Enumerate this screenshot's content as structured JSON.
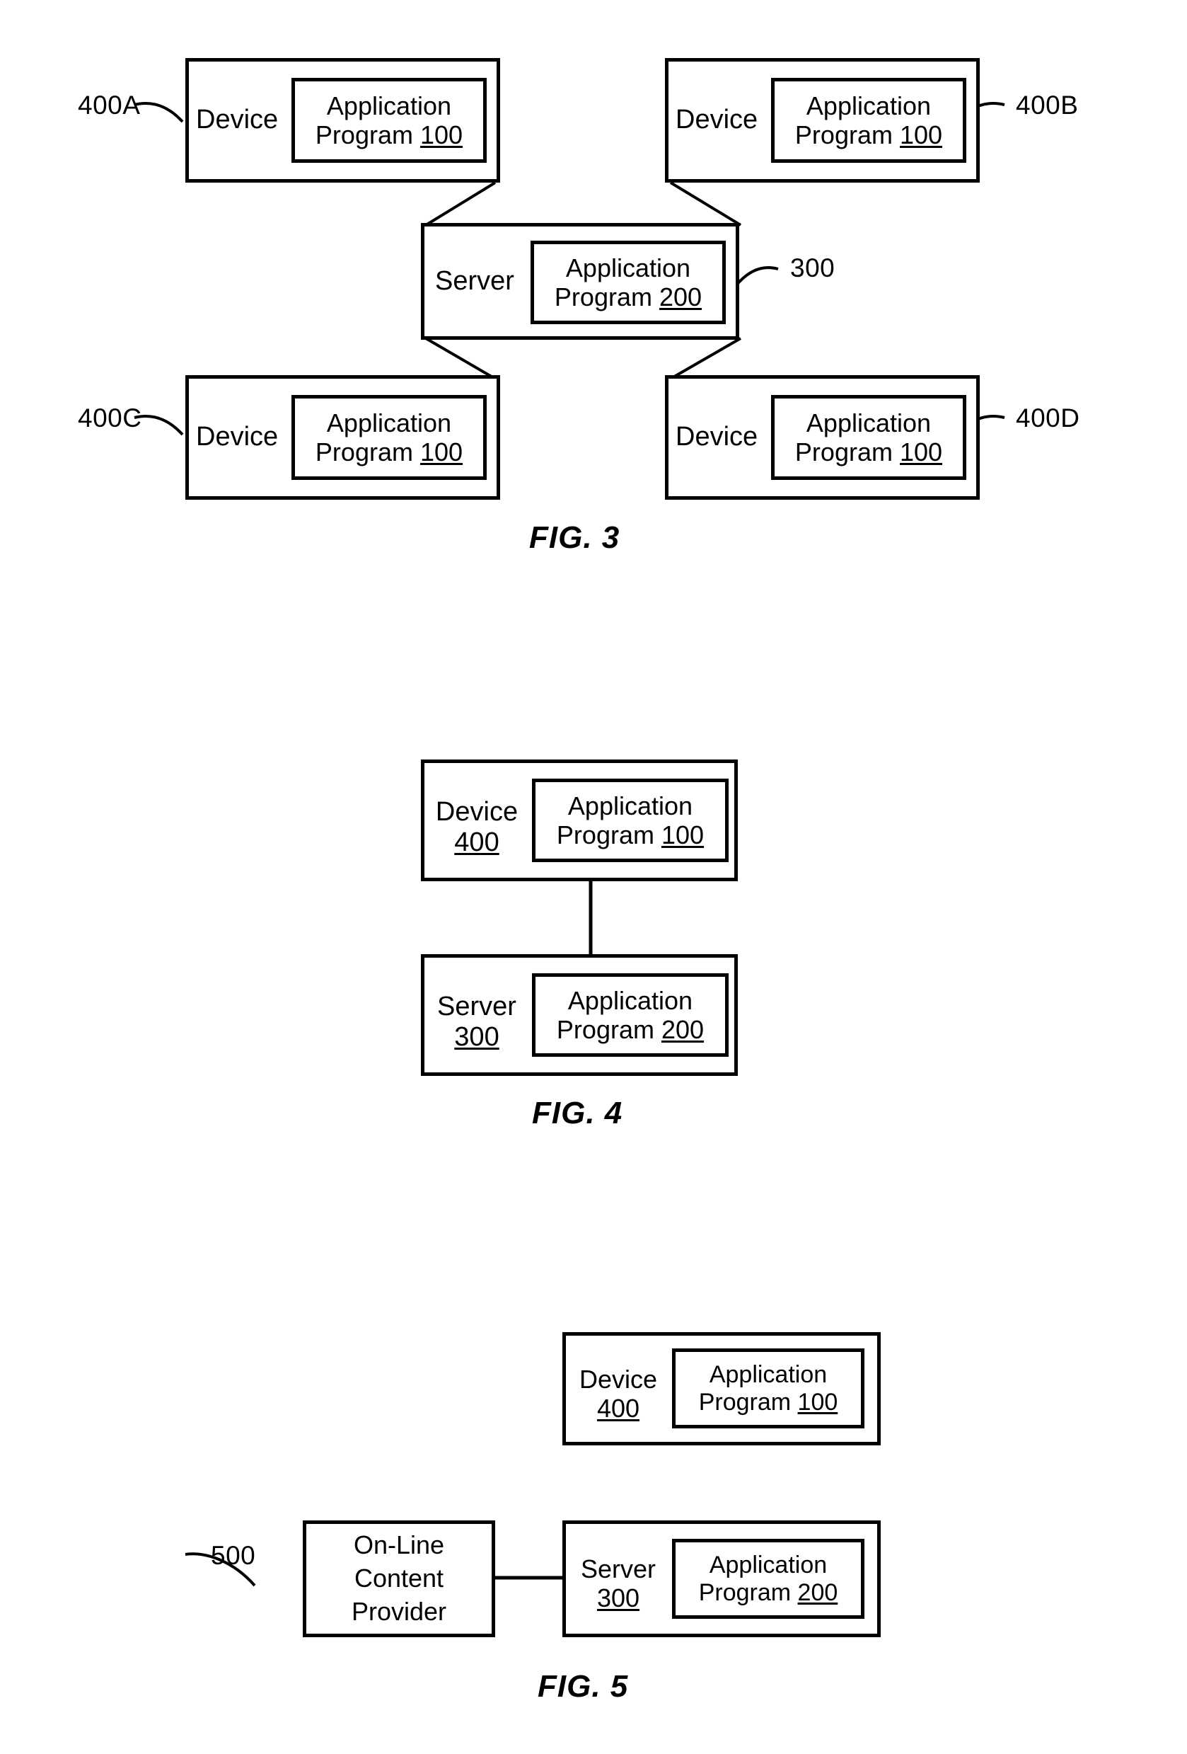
{
  "figures": [
    {
      "id": "fig3",
      "caption": "FIG. 3",
      "nodes": {
        "device_a": {
          "role_label": "Device",
          "program_line1": "Application",
          "program_line2": "Program",
          "program_ref": "100",
          "ref": "400A"
        },
        "device_b": {
          "role_label": "Device",
          "program_line1": "Application",
          "program_line2": "Program",
          "program_ref": "100",
          "ref": "400B"
        },
        "server": {
          "role_label": "Server",
          "program_line1": "Application",
          "program_line2": "Program",
          "program_ref": "200",
          "ref": "300"
        },
        "device_c": {
          "role_label": "Device",
          "program_line1": "Application",
          "program_line2": "Program",
          "program_ref": "100",
          "ref": "400C"
        },
        "device_d": {
          "role_label": "Device",
          "program_line1": "Application",
          "program_line2": "Program",
          "program_ref": "100",
          "ref": "400D"
        }
      }
    },
    {
      "id": "fig4",
      "caption": "FIG. 4",
      "nodes": {
        "device": {
          "role_label": "Device",
          "role_ref": "400",
          "program_line1": "Application",
          "program_line2": "Program",
          "program_ref": "100"
        },
        "server": {
          "role_label": "Server",
          "role_ref": "300",
          "program_line1": "Application",
          "program_line2": "Program",
          "program_ref": "200"
        }
      }
    },
    {
      "id": "fig5",
      "caption": "FIG. 5",
      "nodes": {
        "device": {
          "role_label": "Device",
          "role_ref": "400",
          "program_line1": "Application",
          "program_line2": "Program",
          "program_ref": "100"
        },
        "provider": {
          "line1": "On-Line",
          "line2": "Content",
          "line3": "Provider",
          "ref": "500"
        },
        "server": {
          "role_label": "Server",
          "role_ref": "300",
          "program_line1": "Application",
          "program_line2": "Program",
          "program_ref": "200"
        }
      }
    }
  ],
  "colors": {
    "line": "#000000",
    "background": "#ffffff"
  }
}
